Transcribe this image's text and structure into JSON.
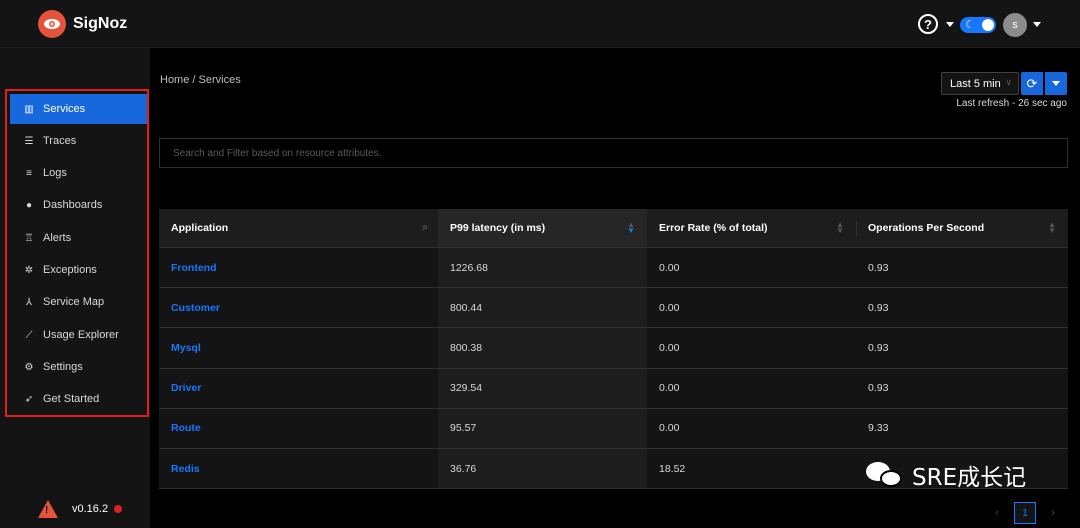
{
  "header": {
    "brand": "SigNoz",
    "help_icon": "question-circle-icon",
    "avatar_initial": "s",
    "theme_toggle": "dark"
  },
  "breadcrumb": "Home  /  Services",
  "sidebar": {
    "items": [
      {
        "label": "Services",
        "icon": "bar-chart-icon",
        "active": true
      },
      {
        "label": "Traces",
        "icon": "menu-icon"
      },
      {
        "label": "Logs",
        "icon": "align-left-icon"
      },
      {
        "label": "Dashboards",
        "icon": "dashboard-icon"
      },
      {
        "label": "Alerts",
        "icon": "alert-icon"
      },
      {
        "label": "Exceptions",
        "icon": "bug-icon"
      },
      {
        "label": "Service Map",
        "icon": "deployment-unit-icon"
      },
      {
        "label": "Usage Explorer",
        "icon": "line-chart-icon"
      },
      {
        "label": "Settings",
        "icon": "setting-icon"
      },
      {
        "label": "Get Started",
        "icon": "rocket-icon"
      }
    ],
    "version": "v0.16.2"
  },
  "toolbar": {
    "time_range": "Last 5 min",
    "last_refresh": "Last refresh - 26 sec ago"
  },
  "search": {
    "placeholder": "Search and Filter based on resource attributes."
  },
  "table": {
    "columns": [
      "Application",
      "P99 latency (in ms)",
      "Error Rate (% of total)",
      "Operations Per Second"
    ],
    "rows": [
      [
        "Frontend",
        "1226.68",
        "0.00",
        "0.93"
      ],
      [
        "Customer",
        "800.44",
        "0.00",
        "0.93"
      ],
      [
        "Mysql",
        "800.38",
        "0.00",
        "0.93"
      ],
      [
        "Driver",
        "329.54",
        "0.00",
        "0.93"
      ],
      [
        "Route",
        "95.57",
        "0.00",
        "9.33"
      ],
      [
        "Redis",
        "36.76",
        "18.52",
        ""
      ]
    ]
  },
  "pagination": {
    "current_page": "1"
  },
  "watermark": "SRE成长记",
  "colors": {
    "accent": "#1668dc",
    "highlight_border": "#e02020",
    "logo": "#e5533d"
  }
}
